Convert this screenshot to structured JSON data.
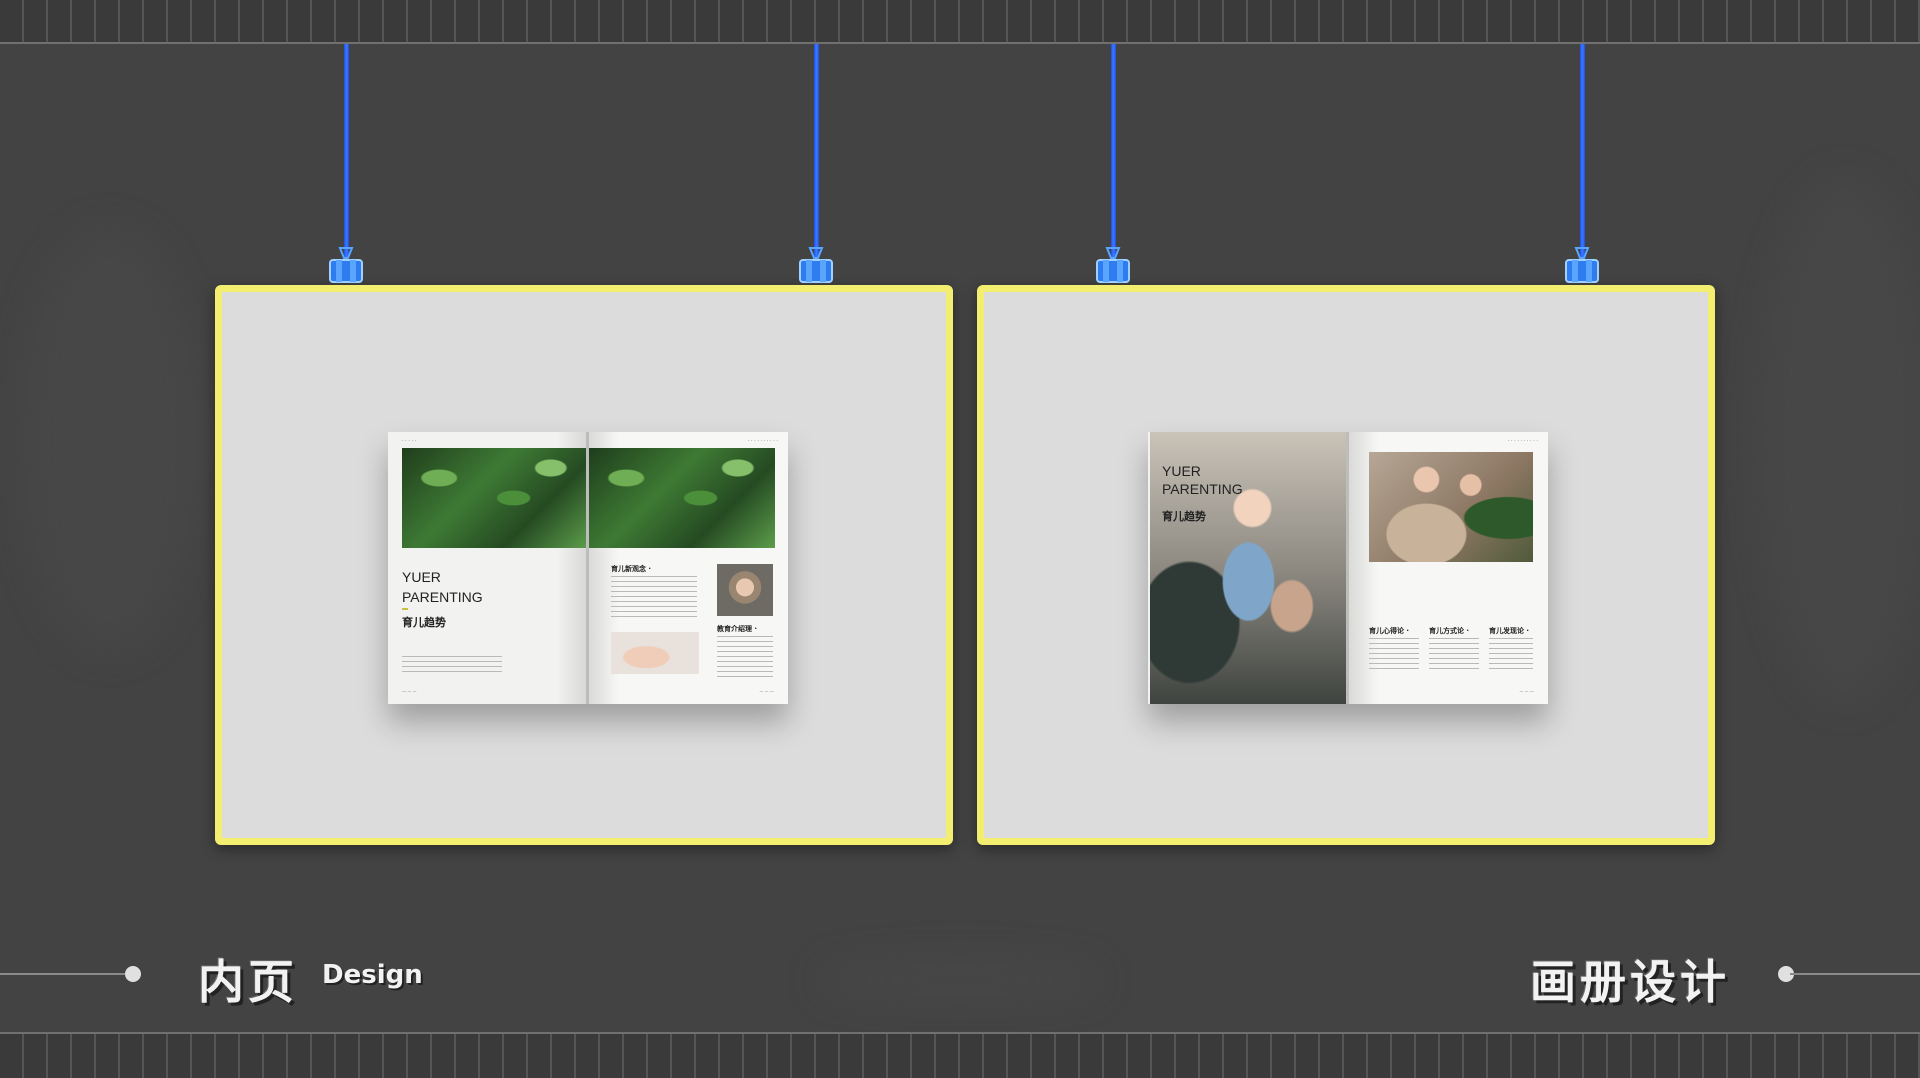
{
  "footer": {
    "left_cn": "内页",
    "left_en": "Design",
    "right_cn": "画册设计"
  },
  "book_left": {
    "title_line1": "YUER",
    "title_line2": "PARENTING",
    "title_cn": "育儿趋势",
    "section1": "育儿新观念 ·",
    "section2": "教育介绍理 ·"
  },
  "book_right": {
    "title_line1": "YUER",
    "title_line2": "PARENTING",
    "title_cn": "育儿趋势",
    "col1": "育儿心得论 ·",
    "col2": "育儿方式论 ·",
    "col3": "育儿发现论 ·"
  },
  "colors": {
    "panel_border": "#f4ee70",
    "wire": "#2f66ff",
    "background": "#434343"
  }
}
